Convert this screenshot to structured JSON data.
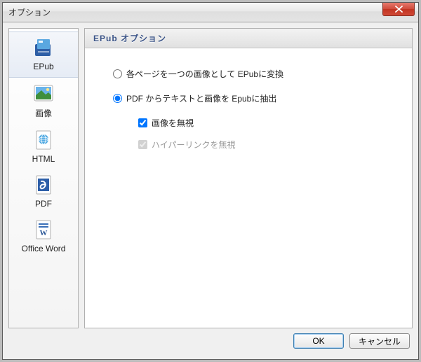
{
  "window": {
    "title": "オプション"
  },
  "sidebar": {
    "items": [
      {
        "label": "EPub"
      },
      {
        "label": "画像"
      },
      {
        "label": "HTML"
      },
      {
        "label": "PDF"
      },
      {
        "label": "Office Word"
      }
    ]
  },
  "panel": {
    "header": "EPub オプション",
    "radio1": "各ページを一つの画像として EPubに変換",
    "radio2": "PDF からテキストと画像を Epubに抽出",
    "check1": "画像を無視",
    "check2": "ハイパーリンクを無視"
  },
  "buttons": {
    "ok": "OK",
    "cancel": "キャンセル"
  }
}
